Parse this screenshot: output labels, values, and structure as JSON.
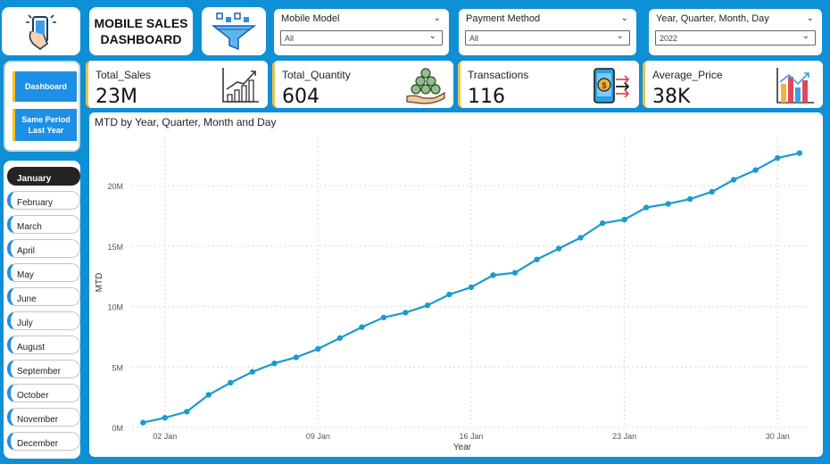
{
  "title": {
    "line1": "MOBILE SALES",
    "line2": "DASHBOARD"
  },
  "slicers": [
    {
      "label": "Mobile Model",
      "value": "All"
    },
    {
      "label": "Payment Method",
      "value": "All"
    },
    {
      "label": "Year, Quarter, Month, Day",
      "value": "2022"
    }
  ],
  "nav": {
    "dashboard": "Dashboard",
    "same_period": "Same Period Last Year"
  },
  "months": [
    "January",
    "February",
    "March",
    "April",
    "May",
    "June",
    "July",
    "August",
    "September",
    "October",
    "November",
    "December"
  ],
  "selected_month": "January",
  "kpis": [
    {
      "label": "Total_Sales",
      "value": "23M",
      "icon": "growth-chart-icon"
    },
    {
      "label": "Total_Quantity",
      "value": "604",
      "icon": "money-stack-icon"
    },
    {
      "label": "Transactions",
      "value": "116",
      "icon": "mobile-payment-icon"
    },
    {
      "label": "Average_Price",
      "value": "38K",
      "icon": "bar-chart-icon"
    }
  ],
  "colors": {
    "background": "#0e8fd6",
    "accent": "#1e8fe6",
    "line": "#1a9bd1",
    "kpi_border": "#e8c34a"
  },
  "chart_data": {
    "type": "line",
    "title": "MTD by Year, Quarter, Month and Day",
    "xlabel": "Year",
    "ylabel": "MTD",
    "x": [
      1,
      2,
      3,
      4,
      5,
      6,
      7,
      8,
      9,
      10,
      11,
      12,
      13,
      14,
      15,
      16,
      17,
      18,
      19,
      20,
      21,
      22,
      23,
      24,
      25,
      26,
      27,
      28,
      29,
      30,
      31
    ],
    "xticks": [
      {
        "day": 2,
        "label": "02 Jan"
      },
      {
        "day": 9,
        "label": "09 Jan"
      },
      {
        "day": 16,
        "label": "16 Jan"
      },
      {
        "day": 23,
        "label": "23 Jan"
      },
      {
        "day": 30,
        "label": "30 Jan"
      }
    ],
    "yticks": [
      {
        "value": 0,
        "label": "0M"
      },
      {
        "value": 5,
        "label": "5M"
      },
      {
        "value": 10,
        "label": "10M"
      },
      {
        "value": 15,
        "label": "15M"
      },
      {
        "value": 20,
        "label": "20M"
      }
    ],
    "series": [
      {
        "values": [
          0.4,
          0.8,
          1.3,
          2.7,
          3.7,
          4.6,
          5.3,
          5.8,
          6.5,
          7.4,
          8.3,
          9.1,
          9.5,
          10.1,
          11.0,
          11.6,
          12.6,
          12.8,
          13.9,
          14.8,
          15.7,
          16.9,
          17.2,
          18.2,
          18.5,
          18.9,
          19.5,
          20.5,
          21.3,
          22.3,
          22.7
        ]
      }
    ],
    "ylim": [
      0,
      24
    ],
    "grid": true
  }
}
